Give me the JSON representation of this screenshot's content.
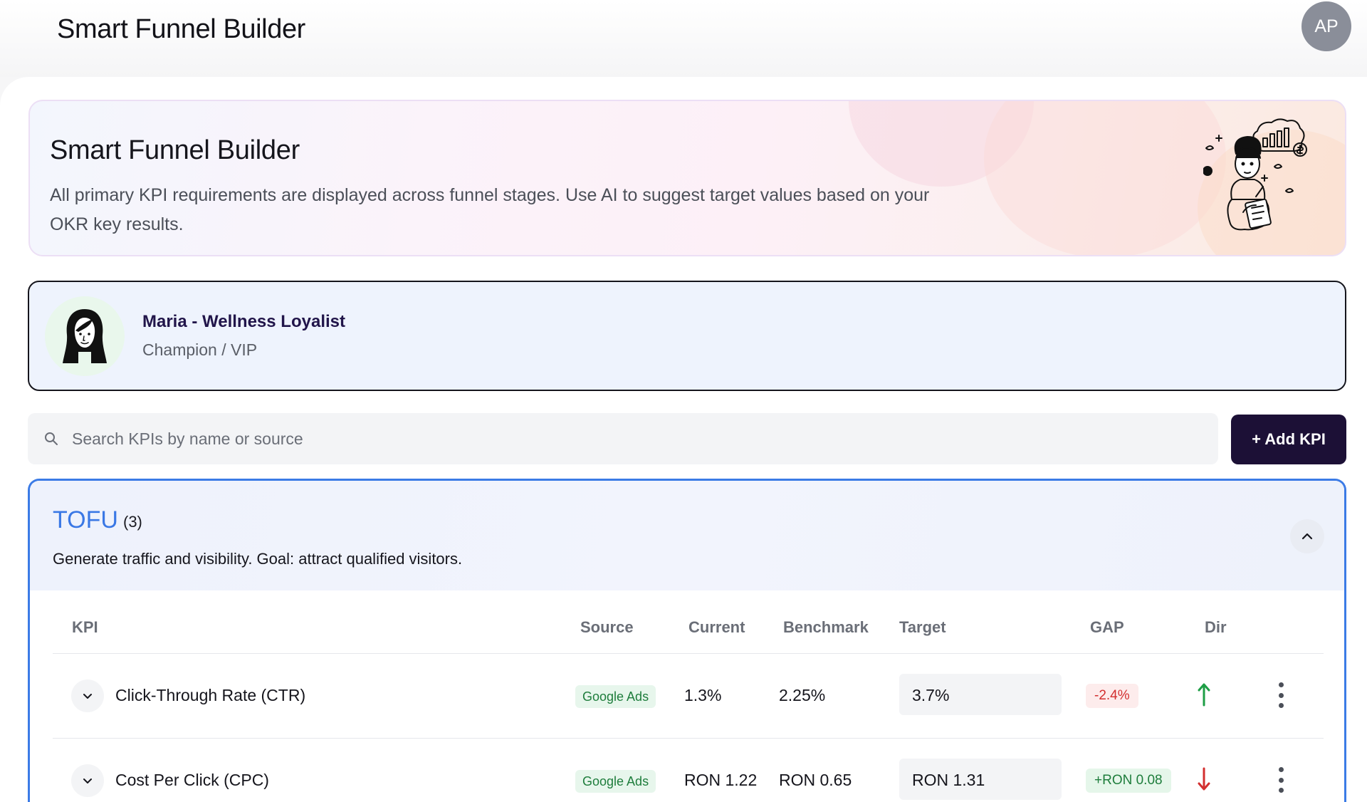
{
  "header": {
    "app_title": "Smart Funnel Builder",
    "avatar_initials": "AP"
  },
  "hero": {
    "title": "Smart Funnel Builder",
    "description": "All primary KPI requirements are displayed across funnel stages. Use AI to suggest target values based on your OKR key results.",
    "illustration_icon": "analyst-illustration-icon"
  },
  "persona": {
    "name": "Maria - Wellness Loyalist",
    "role": "Champion / VIP",
    "avatar_icon": "woman-avatar-icon"
  },
  "search": {
    "placeholder": "Search KPIs by name or source",
    "value": "",
    "icon": "search-icon"
  },
  "actions": {
    "add_kpi_label": "+ Add KPI"
  },
  "stage": {
    "name": "TOFU",
    "count": "(3)",
    "goal": "Generate traffic and visibility. Goal: attract qualified visitors.",
    "expanded": true,
    "accent_color": "#3a78e5"
  },
  "table": {
    "headers": {
      "kpi": "KPI",
      "source": "Source",
      "current": "Current",
      "benchmark": "Benchmark",
      "target": "Target",
      "gap": "GAP",
      "dir": "Dir"
    },
    "rows": [
      {
        "kpi": "Click-Through Rate (CTR)",
        "source": "Google Ads",
        "current": "1.3%",
        "benchmark": "2.25%",
        "target": "3.7%",
        "gap": "-2.4%",
        "gap_status": "negative",
        "direction": "up",
        "direction_color": "#1e9e46"
      },
      {
        "kpi": "Cost Per Click (CPC)",
        "source": "Google Ads",
        "current": "RON 1.22",
        "benchmark": "RON 0.65",
        "target": "RON 1.31",
        "gap": "+RON 0.08",
        "gap_status": "positive",
        "direction": "down",
        "direction_color": "#d32f2f"
      }
    ]
  },
  "colors": {
    "primary_button": "#1c1036",
    "stage_accent": "#3a78e5",
    "positive": "#1e7d3c",
    "negative": "#d32f2f"
  }
}
